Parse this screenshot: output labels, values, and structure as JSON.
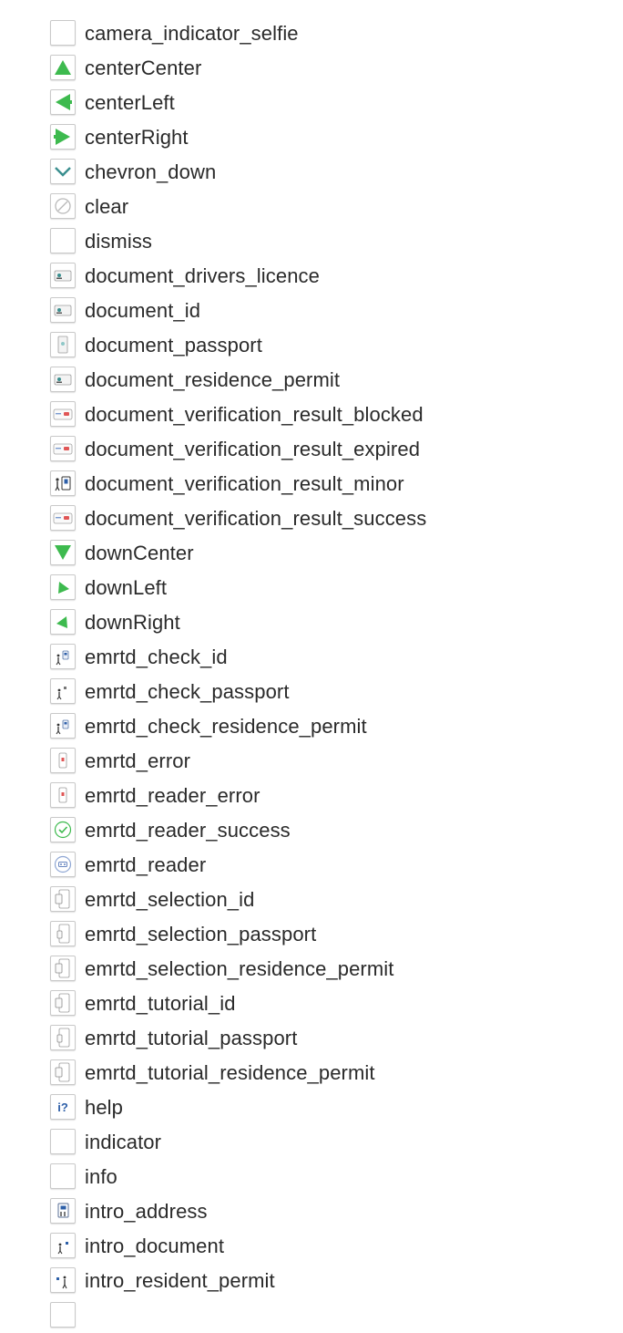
{
  "assets": [
    {
      "name": "camera_indicator_selfie",
      "icon": "blank-icon"
    },
    {
      "name": "centerCenter",
      "icon": "arrow-up-icon"
    },
    {
      "name": "centerLeft",
      "icon": "arrow-left-icon"
    },
    {
      "name": "centerRight",
      "icon": "arrow-right-icon"
    },
    {
      "name": "chevron_down",
      "icon": "chevron-down-icon"
    },
    {
      "name": "clear",
      "icon": "clear-icon"
    },
    {
      "name": "dismiss",
      "icon": "blank-icon"
    },
    {
      "name": "document_drivers_licence",
      "icon": "id-card-icon"
    },
    {
      "name": "document_id",
      "icon": "id-card-icon"
    },
    {
      "name": "document_passport",
      "icon": "passport-icon"
    },
    {
      "name": "document_residence_permit",
      "icon": "id-card-icon"
    },
    {
      "name": "document_verification_result_blocked",
      "icon": "card-red-icon"
    },
    {
      "name": "document_verification_result_expired",
      "icon": "card-red-icon"
    },
    {
      "name": "document_verification_result_minor",
      "icon": "person-card-icon"
    },
    {
      "name": "document_verification_result_success",
      "icon": "card-red-icon"
    },
    {
      "name": "downCenter",
      "icon": "arrow-down-icon"
    },
    {
      "name": "downLeft",
      "icon": "arrow-down-left-icon"
    },
    {
      "name": "downRight",
      "icon": "arrow-down-right-icon"
    },
    {
      "name": "emrtd_check_id",
      "icon": "person-phone-icon"
    },
    {
      "name": "emrtd_check_passport",
      "icon": "person-small-icon"
    },
    {
      "name": "emrtd_check_residence_permit",
      "icon": "person-phone-icon"
    },
    {
      "name": "emrtd_error",
      "icon": "phone-red-icon"
    },
    {
      "name": "emrtd_reader_error",
      "icon": "phone-red-icon"
    },
    {
      "name": "emrtd_reader_success",
      "icon": "check-circle-icon"
    },
    {
      "name": "emrtd_reader",
      "icon": "reader-circle-icon"
    },
    {
      "name": "emrtd_selection_id",
      "icon": "phone-card-icon"
    },
    {
      "name": "emrtd_selection_passport",
      "icon": "phone-passport-icon"
    },
    {
      "name": "emrtd_selection_residence_permit",
      "icon": "phone-card-icon"
    },
    {
      "name": "emrtd_tutorial_id",
      "icon": "phone-card-icon"
    },
    {
      "name": "emrtd_tutorial_passport",
      "icon": "phone-passport-icon"
    },
    {
      "name": "emrtd_tutorial_residence_permit",
      "icon": "phone-card-icon"
    },
    {
      "name": "help",
      "icon": "help-icon"
    },
    {
      "name": "indicator",
      "icon": "blank-icon"
    },
    {
      "name": "info",
      "icon": "blank-icon"
    },
    {
      "name": "intro_address",
      "icon": "intro-address-icon"
    },
    {
      "name": "intro_document",
      "icon": "intro-document-icon"
    },
    {
      "name": "intro_resident_permit",
      "icon": "intro-permit-icon"
    },
    {
      "name": "",
      "icon": "blank-icon"
    }
  ],
  "colors": {
    "green": "#3dba4e",
    "teal": "#3a8f8f",
    "red": "#e05656",
    "blue": "#2d5fa8"
  }
}
